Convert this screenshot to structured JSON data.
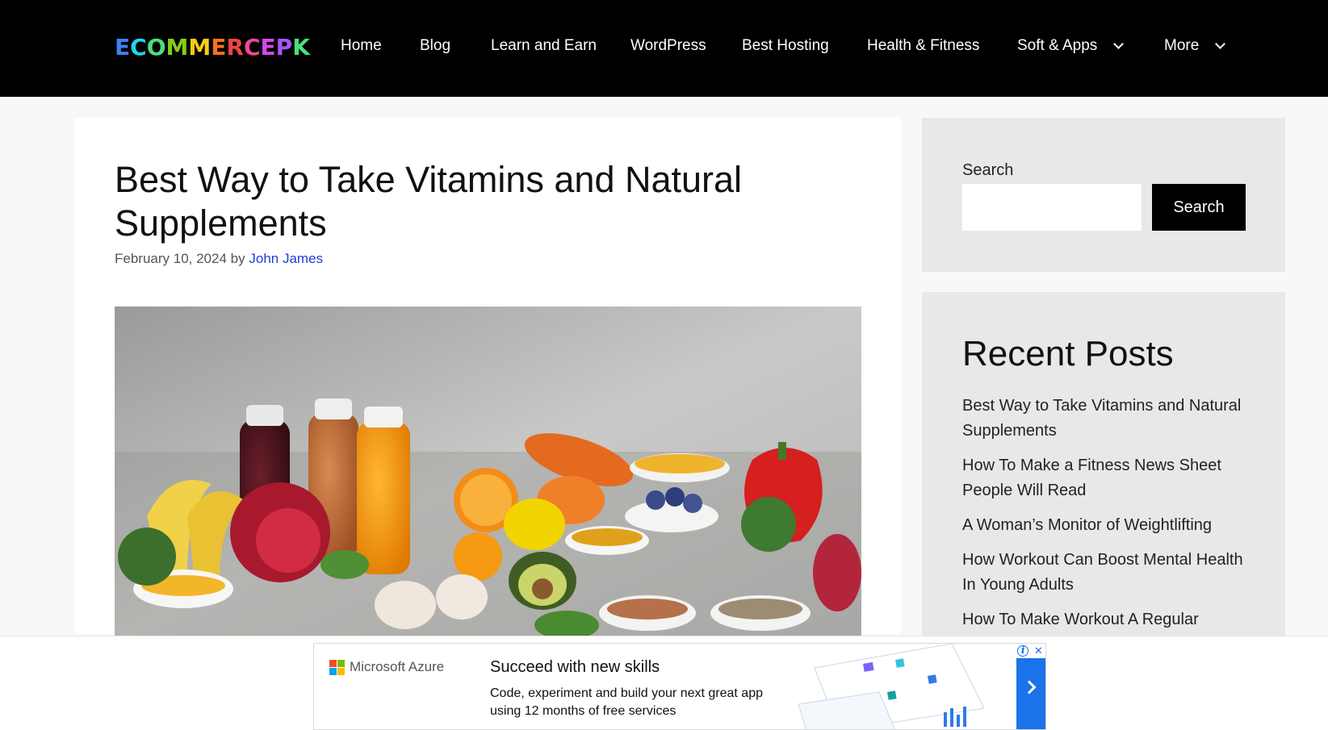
{
  "header": {
    "logo_letters": [
      {
        "char": "E",
        "color": "#3b82f6"
      },
      {
        "char": "C",
        "color": "#22d3ee"
      },
      {
        "char": "O",
        "color": "#4ade80"
      },
      {
        "char": "M",
        "color": "#84cc16"
      },
      {
        "char": "M",
        "color": "#facc15"
      },
      {
        "char": "E",
        "color": "#f97316"
      },
      {
        "char": "R",
        "color": "#ef4444"
      },
      {
        "char": "C",
        "color": "#ec4899"
      },
      {
        "char": "E",
        "color": "#d946ef"
      },
      {
        "char": "P",
        "color": "#a855f7"
      },
      {
        "char": "K",
        "color": "#4ade80"
      }
    ],
    "nav": [
      {
        "label": "Home"
      },
      {
        "label": "Blog"
      },
      {
        "label": "Learn and Earn"
      },
      {
        "label": "WordPress"
      },
      {
        "label": "Best Hosting"
      },
      {
        "label": "Health & Fitness"
      },
      {
        "label": "Soft & Apps"
      },
      {
        "label": "More"
      }
    ]
  },
  "article": {
    "title": "Best Way to Take Vitamins and Natural Supplements",
    "date": "February 10, 2024",
    "by": "by",
    "author": "John James",
    "image_icon": "fruits-vegetables-supplements-photo"
  },
  "sidebar": {
    "search_label": "Search",
    "search_button": "Search",
    "search_value": "",
    "recent_title": "Recent Posts",
    "posts": [
      "Best Way to Take Vitamins and Natural Supplements",
      "How To Make a Fitness News Sheet People Will Read",
      "A Woman’s Monitor of Weightlifting",
      "How Workout Can Boost Mental Health In Young Adults",
      "How To Make Workout A Regular"
    ]
  },
  "ad": {
    "brand": "Microsoft Azure",
    "headline": "Succeed with new skills",
    "body": "Code, experiment and build your next great app using 12 months of free services",
    "accent": "#1a73e8"
  },
  "colors": {
    "header_bg": "#000000",
    "link": "#1e3fd8",
    "sidebar_bg": "#e8e8e8"
  }
}
